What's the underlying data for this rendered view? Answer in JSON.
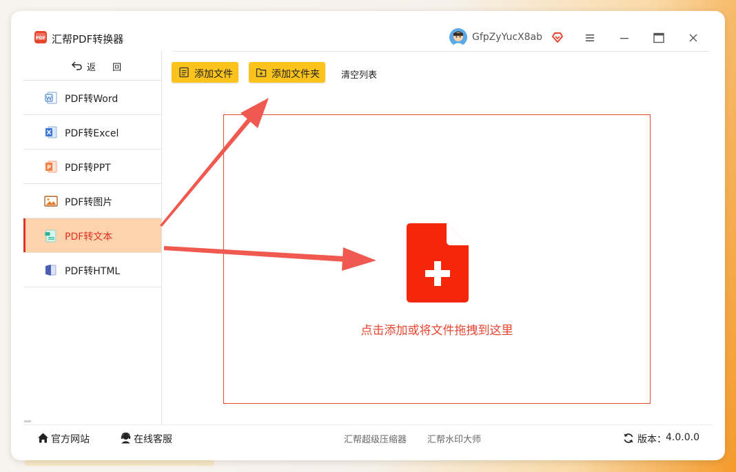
{
  "app": {
    "title": "汇帮PDF转换器",
    "logo_text": "PDF"
  },
  "user": {
    "name": "GfpZyYucX8ab"
  },
  "sidebar": {
    "back_label": "返 回",
    "items": [
      {
        "label": "PDF转Word",
        "icon": "word-icon"
      },
      {
        "label": "PDF转Excel",
        "icon": "excel-icon"
      },
      {
        "label": "PDF转PPT",
        "icon": "ppt-icon"
      },
      {
        "label": "PDF转图片",
        "icon": "image-icon"
      },
      {
        "label": "PDF转文本",
        "icon": "text-icon",
        "active": true
      },
      {
        "label": "PDF转HTML",
        "icon": "html-icon"
      }
    ]
  },
  "toolbar": {
    "add_file": "添加文件",
    "add_folder": "添加文件夹",
    "clear_list": "清空列表"
  },
  "dropzone": {
    "hint": "点击添加或将文件拖拽到这里"
  },
  "footer": {
    "official_site": "官方网站",
    "online_service": "在线客服",
    "apps": [
      "汇帮超级压缩器",
      "汇帮水印大师"
    ],
    "version_label": "版本：",
    "version_value": "4.0.0.0"
  },
  "colors": {
    "accent_red": "#e8452f",
    "button_yellow": "#fbc31c",
    "active_bg": "#fcd3ad"
  }
}
